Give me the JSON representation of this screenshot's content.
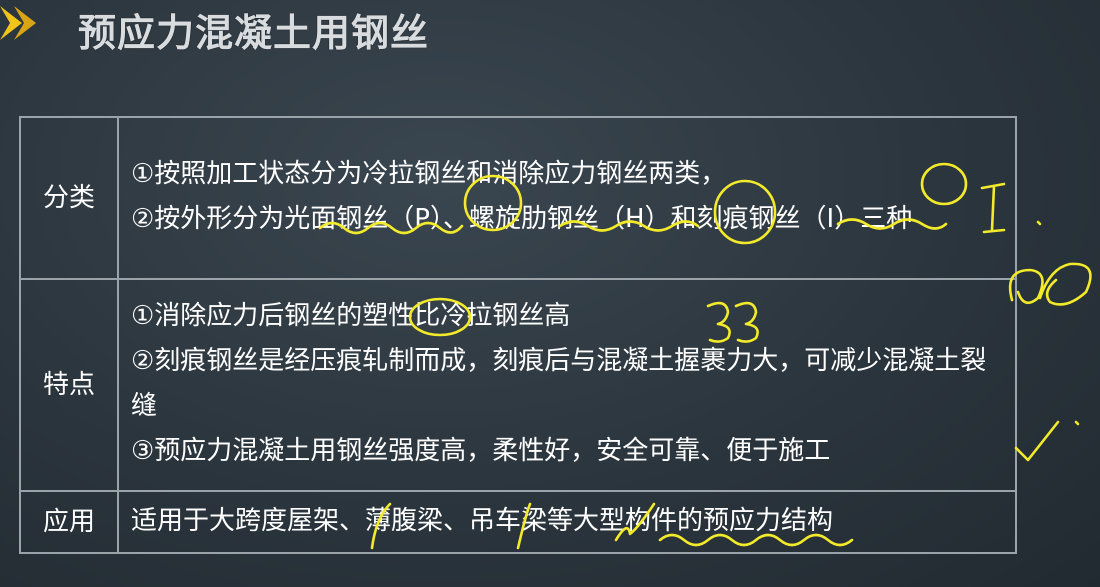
{
  "title": "预应力混凝土用钢丝",
  "icons": {
    "bullet": "arrow-right-icon"
  },
  "colors": {
    "ink": "#f2ea2a",
    "border": "#9aa3aa",
    "background": "#2b353d"
  },
  "rows": [
    {
      "label": "分类",
      "lines": [
        "①按照加工状态分为冷拉钢丝和消除应力钢丝两类，",
        "②按外形分为光面钢丝（P）、螺旋肋钢丝（H）和刻痕钢丝（I）三种"
      ]
    },
    {
      "label": "特点",
      "lines": [
        "①消除应力后钢丝的塑性比冷拉钢丝高",
        "②刻痕钢丝是经压痕轧制而成，刻痕后与混凝土握裹力大，可减少混凝土裂缝",
        "③预应力混凝土用钢丝强度高，柔性好，安全可靠、便于施工"
      ]
    },
    {
      "label": "应用",
      "lines": [
        "适用于大跨度屋架、薄腹梁、吊车梁等大型构件的预应力结构"
      ]
    }
  ]
}
